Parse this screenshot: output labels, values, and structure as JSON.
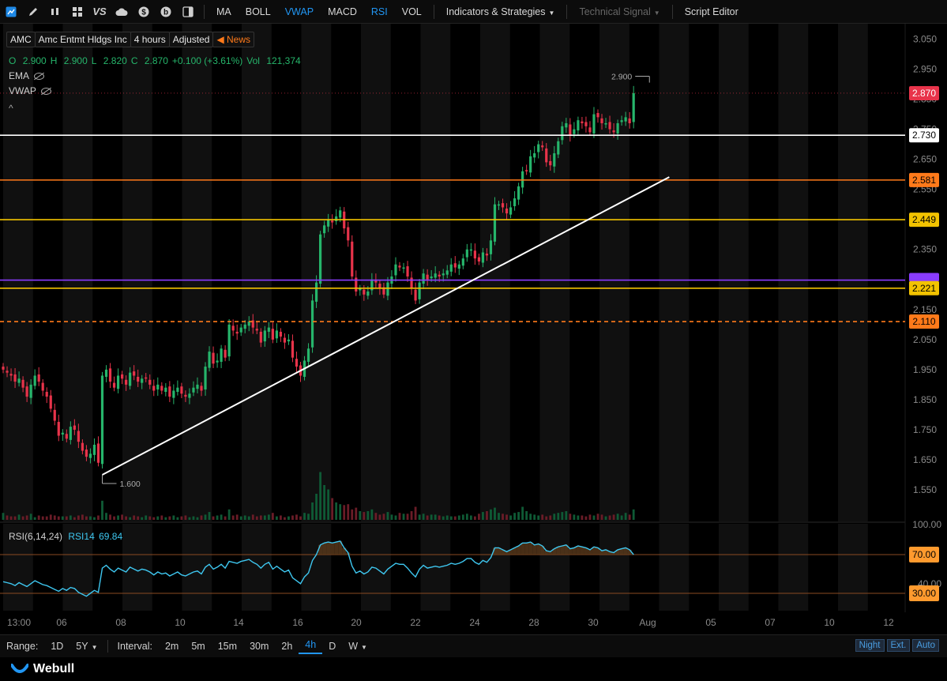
{
  "toolbar": {
    "icons": [
      "chart-icon",
      "pen-icon",
      "candle-icon",
      "layout-icon",
      "vs-icon",
      "cloud-icon",
      "dollar-icon",
      "b-icon",
      "sidebar-icon"
    ],
    "vs_label": "VS",
    "buttons": [
      {
        "label": "MA",
        "state": "normal"
      },
      {
        "label": "BOLL",
        "state": "normal"
      },
      {
        "label": "VWAP",
        "state": "active"
      },
      {
        "label": "MACD",
        "state": "normal"
      },
      {
        "label": "RSI",
        "state": "active"
      },
      {
        "label": "VOL",
        "state": "normal"
      }
    ],
    "indicators_label": "Indicators & Strategies",
    "technical_signal_label": "Technical Signal",
    "script_editor_label": "Script Editor"
  },
  "legend": {
    "symbol": "AMC",
    "name": "Amc Entmt Hldgs Inc",
    "interval": "4 hours",
    "adjust": "Adjusted",
    "news": "News",
    "o_label": "O",
    "o": "2.900",
    "h_label": "H",
    "h": "2.900",
    "l_label": "L",
    "l": "2.820",
    "c_label": "C",
    "c": "2.870",
    "change": "+0.100 (+3.61%)",
    "vol_label": "Vol",
    "vol": "121,374",
    "ema": "EMA",
    "vwap": "VWAP",
    "collapse": "^"
  },
  "chart_data": {
    "type": "candlestick",
    "symbol": "AMC",
    "price_axis": [
      "3.050",
      "2.950",
      "2.850",
      "2.750",
      "2.650",
      "2.550",
      "2.450",
      "2.350",
      "2.250",
      "2.150",
      "2.050",
      "1.950",
      "1.850",
      "1.750",
      "1.650",
      "1.550"
    ],
    "ylim": [
      1.49,
      3.09
    ],
    "last_price": "2.870",
    "last_price_color": "#e8334a",
    "up_color": "#26b56b",
    "down_color": "#e8334a",
    "close_series": [
      1.95,
      1.94,
      1.93,
      1.91,
      1.92,
      1.89,
      1.86,
      1.9,
      1.93,
      1.91,
      1.88,
      1.86,
      1.82,
      1.78,
      1.73,
      1.74,
      1.72,
      1.76,
      1.75,
      1.71,
      1.68,
      1.66,
      1.67,
      1.7,
      1.64,
      1.93,
      1.95,
      1.91,
      1.89,
      1.93,
      1.92,
      1.9,
      1.94,
      1.93,
      1.91,
      1.92,
      1.92,
      1.9,
      1.88,
      1.9,
      1.88,
      1.89,
      1.86,
      1.88,
      1.89,
      1.87,
      1.86,
      1.87,
      1.89,
      1.9,
      1.88,
      1.96,
      2.01,
      1.97,
      1.98,
      2.02,
      1.99,
      2.1,
      2.08,
      2.07,
      2.09,
      2.1,
      2.11,
      2.09,
      2.08,
      2.04,
      2.08,
      2.09,
      2.05,
      2.08,
      2.06,
      2.04,
      2.05,
      1.99,
      1.96,
      1.93,
      1.98,
      2.02,
      2.18,
      2.24,
      2.4,
      2.43,
      2.45,
      2.44,
      2.46,
      2.48,
      2.42,
      2.38,
      2.26,
      2.21,
      2.22,
      2.2,
      2.21,
      2.25,
      2.24,
      2.22,
      2.2,
      2.24,
      2.26,
      2.3,
      2.29,
      2.29,
      2.26,
      2.22,
      2.18,
      2.24,
      2.27,
      2.25,
      2.26,
      2.27,
      2.26,
      2.27,
      2.28,
      2.3,
      2.29,
      2.3,
      2.32,
      2.35,
      2.35,
      2.32,
      2.31,
      2.34,
      2.33,
      2.38,
      2.5,
      2.5,
      2.49,
      2.47,
      2.49,
      2.52,
      2.56,
      2.61,
      2.61,
      2.66,
      2.67,
      2.7,
      2.69,
      2.64,
      2.63,
      2.67,
      2.71,
      2.76,
      2.77,
      2.73,
      2.75,
      2.78,
      2.77,
      2.76,
      2.74,
      2.8,
      2.79,
      2.77,
      2.77,
      2.75,
      2.74,
      2.77,
      2.78,
      2.79,
      2.77,
      2.87
    ],
    "volume_scale_max": 100,
    "volume": [
      8,
      5,
      4,
      4,
      6,
      4,
      5,
      7,
      3,
      5,
      4,
      4,
      6,
      5,
      4,
      4,
      4,
      5,
      3,
      5,
      6,
      4,
      4,
      3,
      5,
      22,
      8,
      6,
      4,
      5,
      6,
      4,
      3,
      5,
      4,
      3,
      5,
      4,
      3,
      4,
      5,
      3,
      4,
      5,
      3,
      4,
      5,
      3,
      4,
      3,
      5,
      6,
      9,
      4,
      5,
      6,
      4,
      12,
      5,
      6,
      4,
      5,
      4,
      6,
      4,
      5,
      5,
      6,
      8,
      4,
      5,
      3,
      4,
      5,
      6,
      4,
      8,
      7,
      20,
      30,
      55,
      40,
      35,
      25,
      20,
      18,
      17,
      18,
      12,
      14,
      10,
      9,
      10,
      12,
      8,
      6,
      7,
      9,
      6,
      5,
      8,
      7,
      7,
      10,
      15,
      6,
      7,
      5,
      6,
      6,
      5,
      4,
      5,
      4,
      4,
      5,
      6,
      7,
      5,
      4,
      7,
      9,
      10,
      12,
      14,
      8,
      7,
      6,
      5,
      8,
      9,
      15,
      10,
      7,
      6,
      5,
      6,
      4,
      5,
      7,
      8,
      9,
      10,
      7,
      6,
      5,
      5,
      4,
      6,
      5,
      7,
      6,
      4,
      5,
      6,
      7,
      5,
      8,
      6,
      12
    ],
    "horizontal_lines": [
      {
        "price": 2.73,
        "color": "#ffffff",
        "style": "solid",
        "label": "2.730"
      },
      {
        "price": 2.581,
        "color": "#ff7a1a",
        "style": "solid",
        "label": "2.581"
      },
      {
        "price": 2.449,
        "color": "#f2c200",
        "style": "solid",
        "label": "2.449"
      },
      {
        "price": 2.248,
        "color": "#8a3cff",
        "style": "solid",
        "label": ""
      },
      {
        "price": 2.221,
        "color": "#f2c200",
        "style": "solid",
        "label": "2.221"
      },
      {
        "price": 2.11,
        "color": "#ff7a1a",
        "style": "dashed",
        "label": "2.110"
      }
    ],
    "trendline": {
      "from": {
        "index": 25,
        "price": 1.6
      },
      "to": {
        "index": 168,
        "price": 2.591
      },
      "color": "#ffffff"
    },
    "annotations": [
      {
        "text": "2.900",
        "index": 163,
        "price": 2.9
      },
      {
        "text": "1.600",
        "index": 25,
        "price": 1.6
      }
    ],
    "rsi": {
      "label": "RSI(6,14,24)",
      "value_label": "RSI14",
      "value": "69.84",
      "axis": [
        "100.00",
        "40.00"
      ],
      "overbought": "70.00",
      "oversold": "30.00",
      "series": [
        42,
        41,
        40,
        38,
        41,
        39,
        37,
        40,
        43,
        41,
        39,
        38,
        36,
        34,
        32,
        35,
        33,
        36,
        35,
        31,
        29,
        27,
        30,
        33,
        31,
        56,
        59,
        55,
        52,
        56,
        54,
        52,
        57,
        55,
        53,
        55,
        54,
        52,
        49,
        52,
        50,
        51,
        48,
        50,
        52,
        49,
        48,
        50,
        52,
        53,
        50,
        57,
        60,
        55,
        57,
        60,
        56,
        63,
        62,
        61,
        63,
        64,
        65,
        62,
        60,
        56,
        60,
        62,
        55,
        58,
        55,
        52,
        54,
        46,
        43,
        40,
        47,
        51,
        64,
        70,
        80,
        82,
        83,
        82,
        83,
        84,
        77,
        72,
        58,
        51,
        53,
        50,
        52,
        57,
        56,
        53,
        50,
        55,
        58,
        61,
        60,
        60,
        56,
        51,
        47,
        55,
        59,
        56,
        57,
        58,
        57,
        58,
        59,
        61,
        60,
        61,
        63,
        66,
        66,
        62,
        60,
        64,
        62,
        67,
        77,
        77,
        75,
        73,
        75,
        77,
        79,
        82,
        82,
        83,
        80,
        81,
        79,
        74,
        73,
        76,
        78,
        79,
        80,
        76,
        77,
        79,
        78,
        77,
        75,
        78,
        77,
        74,
        75,
        73,
        72,
        75,
        76,
        77,
        75,
        70
      ]
    },
    "x_tick_labels": [
      "13:00",
      "06",
      "08",
      "10",
      "14",
      "16",
      "20",
      "22",
      "24",
      "28",
      "30",
      "Aug",
      "05",
      "07",
      "10",
      "12"
    ]
  },
  "bottom_bar": {
    "range_label": "Range:",
    "range_items": [
      "1D",
      "5Y"
    ],
    "interval_label": "Interval:",
    "intervals": [
      "2m",
      "5m",
      "15m",
      "30m",
      "2h",
      "4h",
      "D",
      "W"
    ],
    "active_interval": "4h",
    "modes": [
      "Night",
      "Ext.",
      "Auto"
    ]
  },
  "footer": {
    "brand": "Webull"
  }
}
